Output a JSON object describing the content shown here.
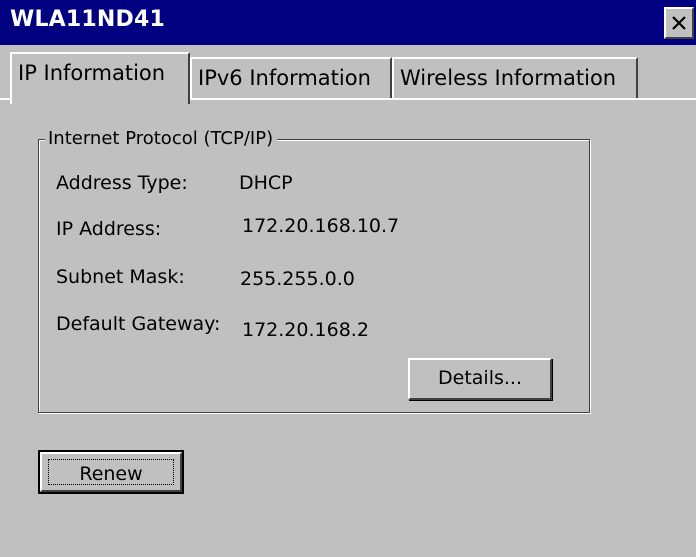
{
  "window": {
    "title": "WLA11ND41",
    "close_icon": "close-icon"
  },
  "tabs": [
    {
      "label": "IP Information",
      "active": true
    },
    {
      "label": "IPv6 Information",
      "active": false
    },
    {
      "label": "Wireless Information",
      "active": false
    }
  ],
  "tcpip": {
    "group_label": "Internet Protocol (TCP/IP)",
    "fields": [
      {
        "label": "Address Type:",
        "value": "DHCP"
      },
      {
        "label": "IP Address:",
        "value": "172.20.168.10.7"
      },
      {
        "label": "Subnet Mask:",
        "value": "255.255.0.0"
      },
      {
        "label": "Default Gateway:",
        "value": "172.20.168.2"
      }
    ],
    "details_button": "Details..."
  },
  "renew_button": "Renew",
  "colors": {
    "titlebar": "#000080",
    "face": "#c0c0c0"
  }
}
